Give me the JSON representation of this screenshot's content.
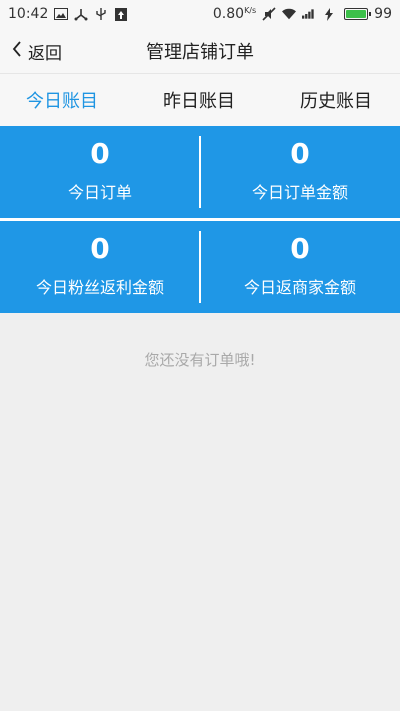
{
  "status_bar": {
    "time": "10:42",
    "net_speed": "0.80",
    "net_unit": "K/s",
    "battery": "99",
    "battery_level_percent": 99,
    "icons": [
      "image-icon",
      "usb-share-icon",
      "usb-icon",
      "upload-icon",
      "mute-icon",
      "wifi-icon",
      "signal-icon",
      "charging-icon",
      "battery-icon"
    ]
  },
  "header": {
    "back_label": "返回",
    "title": "管理店铺订单"
  },
  "tabs": [
    {
      "label": "今日账目",
      "active": true
    },
    {
      "label": "昨日账目",
      "active": false
    },
    {
      "label": "历史账目",
      "active": false
    }
  ],
  "stats": {
    "today_orders": {
      "value": "0",
      "label": "今日订单"
    },
    "today_order_amount": {
      "value": "0",
      "label": "今日订单金额"
    },
    "today_fan_rebate": {
      "value": "0",
      "label": "今日粉丝返利金额"
    },
    "today_merchant_rebate": {
      "value": "0",
      "label": "今日返商家金额"
    }
  },
  "empty_message": "您还没有订单哦!",
  "colors": {
    "accent": "#1f95e2",
    "stats_bg": "#1f97e6",
    "page_bg": "#efefef",
    "empty_text": "#a9a9a9",
    "battery": "#3cc04a"
  }
}
